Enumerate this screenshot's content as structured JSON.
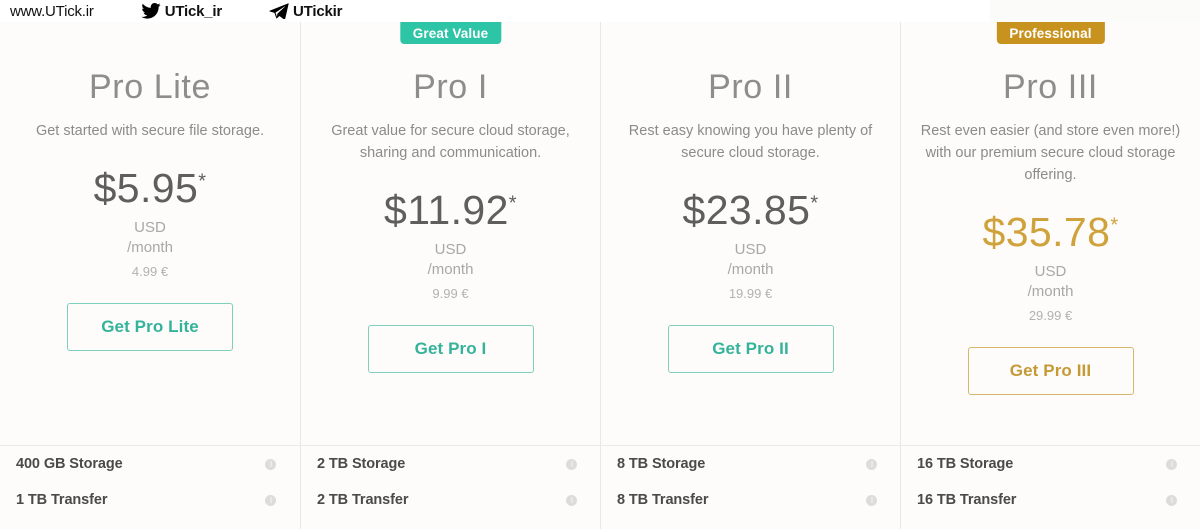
{
  "watermark": {
    "site": "www.UTick.ir",
    "items": [
      {
        "icon": "twitter-bird-icon",
        "label": "UTick_ir"
      },
      {
        "icon": "telegram-paper-plane-icon",
        "label": "UTickir"
      }
    ]
  },
  "colors": {
    "teal": "#2ec4a6",
    "teal_border": "#7fcfbd",
    "teal_text": "#35b39a",
    "gold": "#c8921f",
    "gold_border": "#d7b76d",
    "gold_text": "#c49a36",
    "price_gold": "#cfa23c",
    "heading_gray": "#8e8d8b",
    "body_gray": "#8c8b89",
    "divider": "#e9e8e6",
    "page_bg": "#fcfbfa"
  },
  "plans": [
    {
      "badge": null,
      "name": "Pro Lite",
      "description": "Get started with secure file storage.",
      "price": "$5.95",
      "price_star": "*",
      "currency_line1": "USD",
      "currency_line2": "/month",
      "euro_price": "4.99 €",
      "cta_label": "Get Pro Lite",
      "accent": "teal",
      "features": [
        {
          "label": "400 GB Storage",
          "info": "info-icon"
        },
        {
          "label": "1 TB Transfer",
          "info": "info-icon"
        }
      ]
    },
    {
      "badge": "Great Value",
      "badge_color": "#2ec4a6",
      "name": "Pro I",
      "description": "Great value for secure cloud storage, sharing and communication.",
      "price": "$11.92",
      "price_star": "*",
      "currency_line1": "USD",
      "currency_line2": "/month",
      "euro_price": "9.99 €",
      "cta_label": "Get Pro I",
      "accent": "teal",
      "features": [
        {
          "label": "2 TB Storage",
          "info": "info-icon"
        },
        {
          "label": "2 TB Transfer",
          "info": "info-icon"
        }
      ]
    },
    {
      "badge": null,
      "name": "Pro II",
      "description": "Rest easy knowing you have plenty of secure cloud storage.",
      "price": "$23.85",
      "price_star": "*",
      "currency_line1": "USD",
      "currency_line2": "/month",
      "euro_price": "19.99 €",
      "cta_label": "Get Pro II",
      "accent": "teal",
      "features": [
        {
          "label": "8 TB Storage",
          "info": "info-icon"
        },
        {
          "label": "8 TB Transfer",
          "info": "info-icon"
        }
      ]
    },
    {
      "badge": "Professional",
      "badge_color": "#c8921f",
      "name": "Pro III",
      "description": "Rest even easier (and store even more!) with our premium secure cloud storage offering.",
      "price": "$35.78",
      "price_star": "*",
      "currency_line1": "USD",
      "currency_line2": "/month",
      "euro_price": "29.99 €",
      "cta_label": "Get Pro III",
      "accent": "gold",
      "features": [
        {
          "label": "16 TB Storage",
          "info": "info-icon"
        },
        {
          "label": "16 TB Transfer",
          "info": "info-icon"
        }
      ]
    }
  ]
}
